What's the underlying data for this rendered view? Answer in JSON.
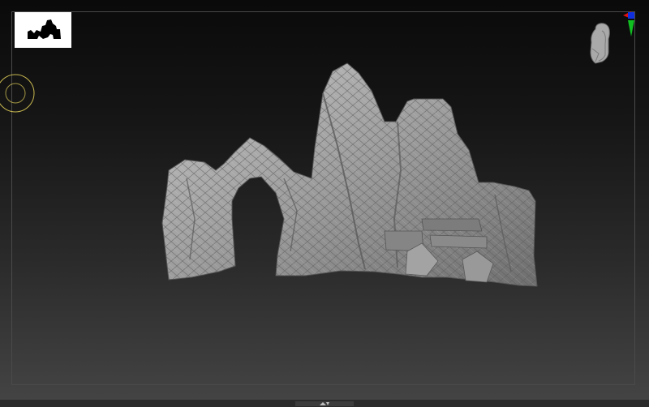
{
  "viewport": {
    "background_top": "#0a0a0a",
    "background_bottom": "#454545",
    "frame_color": "#4a4a4a"
  },
  "thumbnail": {
    "icon": "silhouette-thumbnail-icon",
    "background": "#ffffff",
    "silhouette_color": "#000000"
  },
  "navigation": {
    "rotate_ring_icon": "rotate-ring-icon",
    "ring_color": "#c8b850",
    "navcube_icon": "head-navcube-icon",
    "axis_colors": {
      "x": "#e01010",
      "y": "#10c020",
      "z": "#1030e0"
    }
  },
  "model": {
    "icon": "rock-arch-sculpt",
    "material_color": "#9a9a9a"
  },
  "bottom_bar": {
    "handle_icon": "expand-handle-icon"
  }
}
